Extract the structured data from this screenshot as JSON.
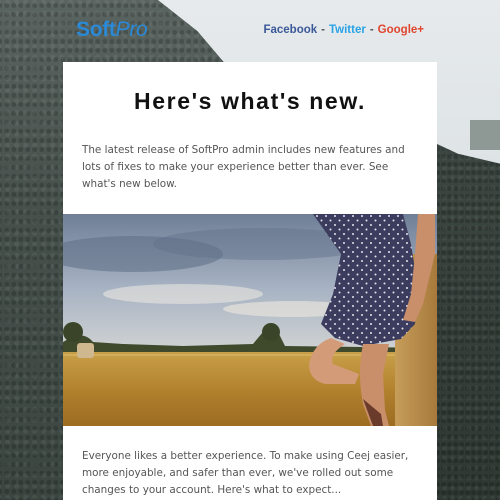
{
  "header": {
    "logo_bold": "Soft",
    "logo_light": "Pro",
    "social": {
      "facebook": "Facebook",
      "twitter": "Twitter",
      "google": "Google+",
      "separator": "-"
    }
  },
  "card": {
    "title": "Here's what's new.",
    "intro": "The latest release of SoftPro admin includes new features and lots of fixes to make your experience better than ever. See what's new below.",
    "body": "Everyone likes a better experience. To make using Ceej easier, more enjoyable, and safer than ever, we've rolled out some changes to your account. Here's what to expect..."
  },
  "colors": {
    "brand": "#2a8ad8",
    "facebook": "#3b5898",
    "twitter": "#29a3e6",
    "google": "#e0452f"
  }
}
